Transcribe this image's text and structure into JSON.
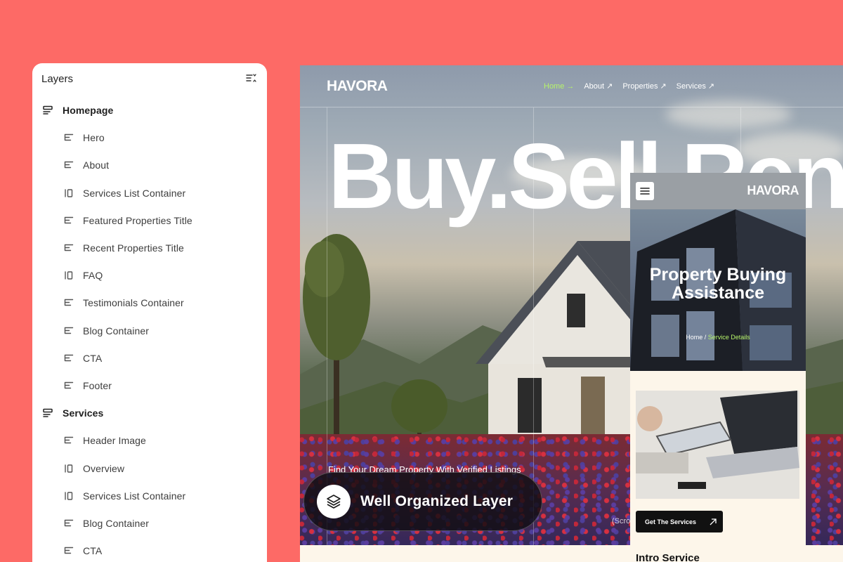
{
  "layers_panel": {
    "title": "Layers",
    "groups": [
      {
        "label": "Homepage",
        "items": [
          {
            "label": "Hero",
            "icon": "stack-icon"
          },
          {
            "label": "About",
            "icon": "stack-icon"
          },
          {
            "label": "Services List Container",
            "icon": "columns-icon"
          },
          {
            "label": "Featured Properties Title",
            "icon": "stack-icon"
          },
          {
            "label": "Recent Properties Title",
            "icon": "stack-icon"
          },
          {
            "label": "FAQ",
            "icon": "columns-icon"
          },
          {
            "label": "Testimonials Container",
            "icon": "stack-icon"
          },
          {
            "label": "Blog Container",
            "icon": "stack-icon"
          },
          {
            "label": "CTA",
            "icon": "stack-icon"
          },
          {
            "label": "Footer",
            "icon": "stack-icon"
          }
        ]
      },
      {
        "label": "Services",
        "items": [
          {
            "label": "Header Image",
            "icon": "stack-icon"
          },
          {
            "label": "Overview",
            "icon": "columns-icon"
          },
          {
            "label": "Services List Container",
            "icon": "columns-icon"
          },
          {
            "label": "Blog Container",
            "icon": "stack-icon"
          },
          {
            "label": "CTA",
            "icon": "stack-icon"
          }
        ]
      }
    ]
  },
  "site": {
    "logo": "HAVORA",
    "nav": [
      {
        "label": "Home",
        "arrow": "→",
        "active": true
      },
      {
        "label": "About",
        "arrow": "↗",
        "active": false
      },
      {
        "label": "Properties",
        "arrow": "↗",
        "active": false
      },
      {
        "label": "Services",
        "arrow": "↗",
        "active": false
      }
    ],
    "headline": "Buy.Sell.Rent",
    "tagline": "Find Your Dream Property With Verified Listings",
    "scroll_hint": "(Scro"
  },
  "badge": {
    "text": "Well Organized Layer",
    "icon": "layers-icon"
  },
  "mobile": {
    "logo": "HAVORA",
    "title_line1": "Property Buying",
    "title_line2": "Assistance",
    "breadcrumb_home": "Home",
    "breadcrumb_sep": " / ",
    "breadcrumb_current": "Service Details",
    "button_label": "Get The Services",
    "section_title": "Intro Service"
  },
  "colors": {
    "background": "#fd6a66",
    "accent_green": "#b6f36a",
    "cream": "#fdf6ea"
  }
}
